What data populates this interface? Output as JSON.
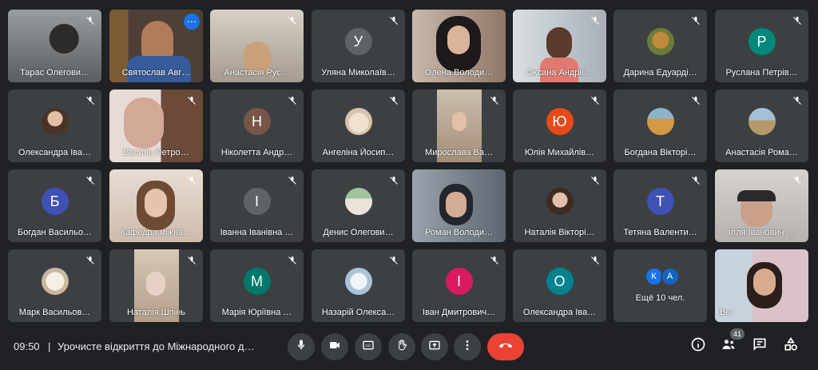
{
  "participants": [
    {
      "name": "Тарас Олегови…"
    },
    {
      "name": "Святослав Авг…"
    },
    {
      "name": "Анастасія Рус…"
    },
    {
      "name": "Уляна Миколаїв…",
      "initial": "У"
    },
    {
      "name": "Олена Володи…"
    },
    {
      "name": "Оксана Андрії…"
    },
    {
      "name": "Дарина Едуарді…"
    },
    {
      "name": "Руслана Петрів…",
      "initial": "Р"
    },
    {
      "name": "Олександра Іва…"
    },
    {
      "name": "Василь Петро…"
    },
    {
      "name": "Ніколетта Андр…",
      "initial": "Н"
    },
    {
      "name": "Ангеліна Йосип…"
    },
    {
      "name": "Мирослава Ва…"
    },
    {
      "name": "Юлія Михайлів…",
      "initial": "Ю"
    },
    {
      "name": "Богдана Вікторі…"
    },
    {
      "name": "Анастасія Рома…"
    },
    {
      "name": "Богдан Васильо…",
      "initial": "Б"
    },
    {
      "name": "Кафедра міжна…"
    },
    {
      "name": "Іванна Іванівна …",
      "initial": "І"
    },
    {
      "name": "Денис Олегови…"
    },
    {
      "name": "Роман Володи…"
    },
    {
      "name": "Наталія Вікторі…"
    },
    {
      "name": "Тетяна Валенти…",
      "initial": "Т"
    },
    {
      "name": "Ілля Іванович …"
    },
    {
      "name": "Марк Васильов…"
    },
    {
      "name": "Наталія Шпінь"
    },
    {
      "name": "Марія Юріївна …",
      "initial": "М"
    },
    {
      "name": "Назарій Олекса…"
    },
    {
      "name": "Іван Дмитрович…",
      "initial": "І"
    },
    {
      "name": "Олександра Іва…",
      "initial": "О"
    }
  ],
  "more_tile": {
    "label": "Ещё 10 чел.",
    "initials": [
      "К",
      "А"
    ]
  },
  "self_tile": {
    "label": "Вы"
  },
  "bottom": {
    "time": "09:50",
    "separator": "|",
    "meeting_title": "Урочисте відкриття до Міжнародного д…",
    "participant_count": "41"
  },
  "colors": {
    "accent": "#8ab4f8",
    "end_call": "#ea4335",
    "avatars": {
      "У": "#5f6368",
      "Р": "#00897b",
      "Н": "#795548",
      "Ю": "#e64a19",
      "Б": "#3f51b5",
      "І1": "#5f6368",
      "Т": "#3f51b5",
      "М": "#00796b",
      "І2": "#d81b60",
      "О": "#00838f",
      "К": "#1a73e8",
      "А": "#1565c0"
    }
  }
}
